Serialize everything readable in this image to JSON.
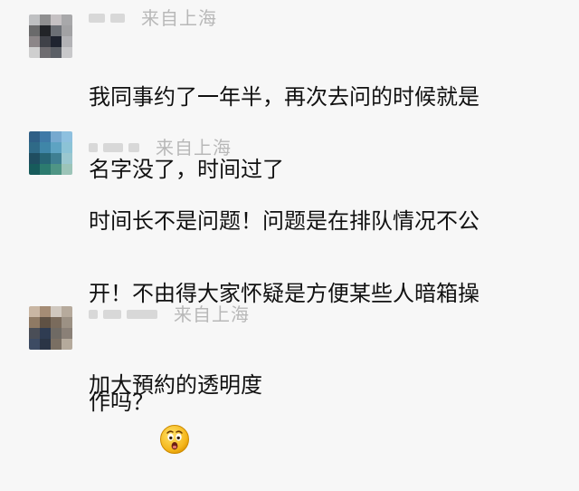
{
  "comments": [
    {
      "location_label": "来自上海",
      "text_line_1": "我同事约了一年半，再次去问的时候就是",
      "text_line_2": "名字没了，时间过了",
      "avatar_colors": [
        "#bfc0c2",
        "#8f8f90",
        "#c5c1c3",
        "#a8a8aa",
        "#6a6a6b",
        "#222428",
        "#6b6f75",
        "#a2a2a4",
        "#8c8688",
        "#3f4148",
        "#1f2430",
        "#b2b2b5",
        "#cfcfcf",
        "#6e6c70",
        "#5b5f66",
        "#c8c8ca"
      ]
    },
    {
      "location_label": "来自上海",
      "text_line_1": "时间长不是问题！问题是在排队情况不公",
      "text_line_2": "开！不由得大家怀疑是方便某些人暗箱操",
      "text_line_3": "作吗？",
      "emoji_name": "surprised-face-icon",
      "avatar_colors": [
        "#2f5f86",
        "#3f7aa7",
        "#77a9cf",
        "#8ec0df",
        "#2f6a87",
        "#3f86a8",
        "#5ea3c2",
        "#8cc3d6",
        "#1f4d60",
        "#276575",
        "#3f7f92",
        "#9ac7cf",
        "#175b5b",
        "#2c7b6f",
        "#4f9585",
        "#9cc4b8"
      ]
    },
    {
      "location_label": "来自上海",
      "text_line_1": "加大預約的透明度",
      "avatar_colors": [
        "#c9b6a3",
        "#a58c75",
        "#d0c8bf",
        "#b6aa9c",
        "#8f7a64",
        "#5f5144",
        "#7a6b5c",
        "#9c9184",
        "#4a4e57",
        "#2f3c52",
        "#6f6a64",
        "#8a8077",
        "#3d4b63",
        "#2b3546",
        "#7a6f63",
        "#b5aa9c"
      ]
    }
  ],
  "colors": {
    "background": "#f7f7f7",
    "text": "#111111",
    "meta": "#b8b8b8",
    "emoji_face": "#f5b71c"
  }
}
